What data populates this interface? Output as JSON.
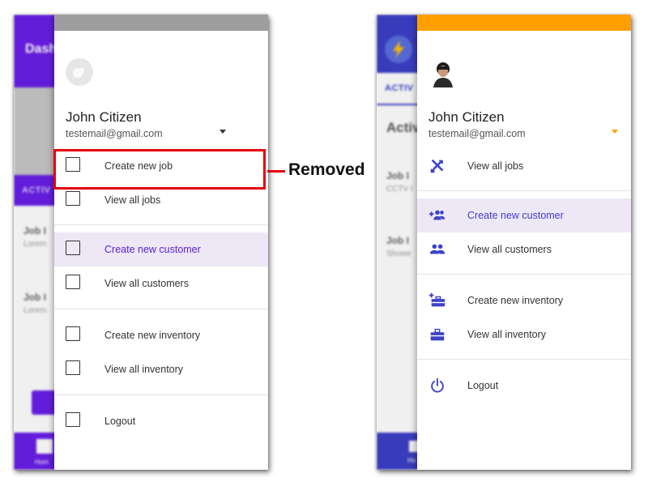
{
  "annotation": {
    "label": "Removed",
    "color": "#e4000f"
  },
  "before": {
    "background": {
      "title": "Dash",
      "tab": "ACTIV",
      "cards": [
        {
          "title": "Job I",
          "subtitle": "Lorem"
        },
        {
          "title": "Job I",
          "subtitle": "Lorem"
        }
      ],
      "bottom_label": "Hom",
      "accent": "#6200ee"
    },
    "drawer": {
      "header_color": "#9e9e9e",
      "avatar_icon": "placeholder-logo-icon",
      "user_name": "John Citizen",
      "user_email": "testemail@gmail.com",
      "menu": [
        {
          "label": "Create new job",
          "icon": "checkbox-placeholder-icon"
        },
        {
          "label": "View all jobs",
          "icon": "checkbox-placeholder-icon"
        },
        {
          "label": "Create new customer",
          "icon": "checkbox-placeholder-icon",
          "active": true
        },
        {
          "label": "View all customers",
          "icon": "checkbox-placeholder-icon"
        },
        {
          "label": "Create new inventory",
          "icon": "checkbox-placeholder-icon"
        },
        {
          "label": "View all inventory",
          "icon": "checkbox-placeholder-icon"
        },
        {
          "label": "Logout",
          "icon": "checkbox-placeholder-icon"
        }
      ]
    }
  },
  "after": {
    "background": {
      "tab": "ACTIV",
      "heading": "Activ",
      "cards": [
        {
          "title": "Job I",
          "subtitle": "CCTV I"
        },
        {
          "title": "Job I",
          "subtitle": "Showe"
        }
      ],
      "bottom_label": "Ho",
      "accent": "#3d40c6"
    },
    "drawer": {
      "header_color": "#ffa000",
      "avatar_icon": "user-photo-icon",
      "user_name": "John Citizen",
      "user_email": "testemail@gmail.com",
      "menu": [
        {
          "label": "View all jobs",
          "icon": "tools-icon"
        },
        {
          "label": "Create new customer",
          "icon": "add-people-icon",
          "active": true
        },
        {
          "label": "View all customers",
          "icon": "people-icon"
        },
        {
          "label": "Create new inventory",
          "icon": "add-toolbox-icon"
        },
        {
          "label": "View all inventory",
          "icon": "toolbox-icon"
        },
        {
          "label": "Logout",
          "icon": "power-icon"
        }
      ]
    }
  }
}
